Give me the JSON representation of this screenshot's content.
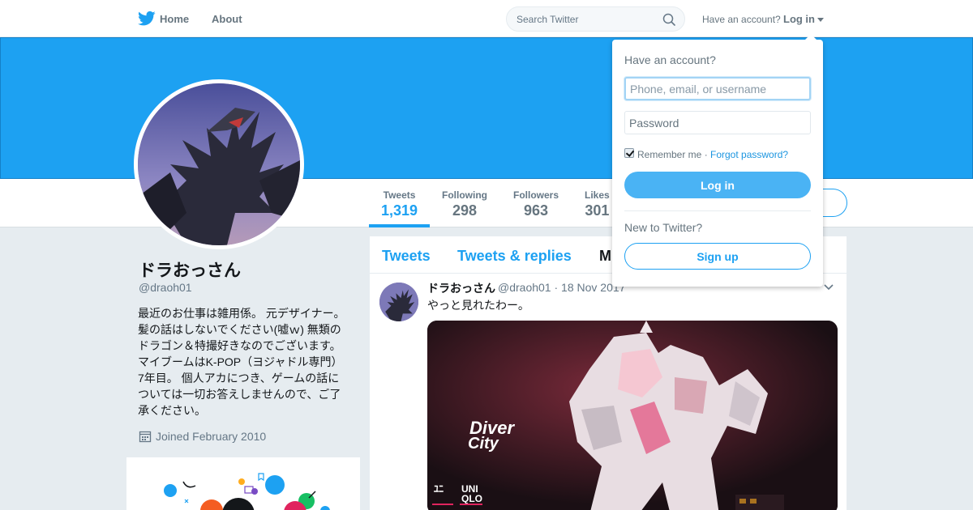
{
  "nav": {
    "home_label": "Home",
    "about_label": "About",
    "search_placeholder": "Search Twitter",
    "have_account": "Have an account?",
    "login_label": "Log in"
  },
  "profile": {
    "name": "ドラおっさん",
    "handle": "@draoh01",
    "bio_lines": [
      "最近のお仕事は雑用係。 元デザイナー。",
      "髪の話はしないでください(嘘ｗ) 無類の",
      "ドラゴン＆特撮好きなのでございます。",
      "マイブームはK-POP（ヨジャドル専門）",
      "7年目。 個人アカにつき、ゲームの話に",
      "ついては一切お答えしませんので、ご了",
      "承ください。"
    ],
    "joined": "Joined February 2010"
  },
  "stats": {
    "tweets_label": "Tweets",
    "tweets_value": "1,319",
    "following_label": "Following",
    "following_value": "298",
    "followers_label": "Followers",
    "followers_value": "963",
    "likes_label": "Likes",
    "likes_value": "301"
  },
  "timeline": {
    "tabs": [
      "Tweets",
      "Tweets & replies",
      "M"
    ],
    "tweet": {
      "name": "ドラおっさん",
      "meta": "@draoh01 · 18 Nov 2017",
      "text": "やっと見れたわー。"
    }
  },
  "login_dropdown": {
    "title": "Have an account?",
    "username_placeholder": "Phone, email, or username",
    "password_placeholder": "Password",
    "remember_label": "Remember me ·",
    "forgot_label": "Forgot password?",
    "login_button": "Log in",
    "new_label": "New to Twitter?",
    "signup_button": "Sign up"
  },
  "colors": {
    "brand_blue": "#1da1f2",
    "background": "#e6ecf0"
  },
  "icons": [
    "twitter-bird-icon",
    "search-icon",
    "caret-down-icon",
    "calendar-icon",
    "chevron-down-icon"
  ]
}
